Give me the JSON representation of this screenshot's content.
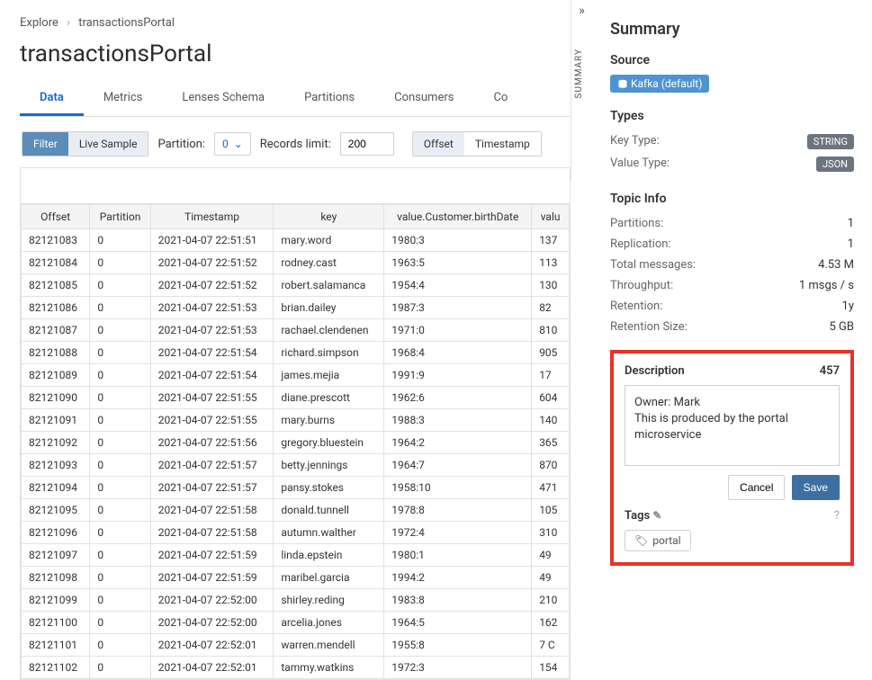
{
  "breadcrumb": {
    "root": "Explore",
    "current": "transactionsPortal"
  },
  "title": "transactionsPortal",
  "tabs": [
    "Data",
    "Metrics",
    "Lenses Schema",
    "Partitions",
    "Consumers",
    "Co"
  ],
  "active_tab": 0,
  "controls": {
    "filter": "Filter",
    "live_sample": "Live Sample",
    "partition_label": "Partition:",
    "partition_value": "0",
    "records_label": "Records limit:",
    "records_value": "200",
    "offset": "Offset",
    "timestamp": "Timestamp"
  },
  "table": {
    "headers": [
      "Offset",
      "Partition",
      "Timestamp",
      "key",
      "value.Customer.birthDate",
      "valu"
    ],
    "rows": [
      [
        "82121083",
        "0",
        "2021-04-07 22:51:51",
        "mary.word",
        "1980:3",
        "137"
      ],
      [
        "82121084",
        "0",
        "2021-04-07 22:51:52",
        "rodney.cast",
        "1963:5",
        "113"
      ],
      [
        "82121085",
        "0",
        "2021-04-07 22:51:52",
        "robert.salamanca",
        "1954:4",
        "130"
      ],
      [
        "82121086",
        "0",
        "2021-04-07 22:51:53",
        "brian.dailey",
        "1987:3",
        "82 "
      ],
      [
        "82121087",
        "0",
        "2021-04-07 22:51:53",
        "rachael.clendenen",
        "1971:0",
        "810"
      ],
      [
        "82121088",
        "0",
        "2021-04-07 22:51:54",
        "richard.simpson",
        "1968:4",
        "905"
      ],
      [
        "82121089",
        "0",
        "2021-04-07 22:51:54",
        "james.mejia",
        "1991:9",
        "17 "
      ],
      [
        "82121090",
        "0",
        "2021-04-07 22:51:55",
        "diane.prescott",
        "1962:6",
        "604"
      ],
      [
        "82121091",
        "0",
        "2021-04-07 22:51:55",
        "mary.burns",
        "1988:3",
        "140"
      ],
      [
        "82121092",
        "0",
        "2021-04-07 22:51:56",
        "gregory.bluestein",
        "1964:2",
        "365"
      ],
      [
        "82121093",
        "0",
        "2021-04-07 22:51:57",
        "betty.jennings",
        "1964:7",
        "870"
      ],
      [
        "82121094",
        "0",
        "2021-04-07 22:51:57",
        "pansy.stokes",
        "1958:10",
        "471"
      ],
      [
        "82121095",
        "0",
        "2021-04-07 22:51:58",
        "donald.tunnell",
        "1978:8",
        "105"
      ],
      [
        "82121096",
        "0",
        "2021-04-07 22:51:58",
        "autumn.walther",
        "1972:4",
        "310"
      ],
      [
        "82121097",
        "0",
        "2021-04-07 22:51:59",
        "linda.epstein",
        "1980:1",
        "49 "
      ],
      [
        "82121098",
        "0",
        "2021-04-07 22:51:59",
        "maribel.garcia",
        "1994:2",
        "49 "
      ],
      [
        "82121099",
        "0",
        "2021-04-07 22:52:00",
        "shirley.reding",
        "1983:8",
        "210"
      ],
      [
        "82121100",
        "0",
        "2021-04-07 22:52:00",
        "arcelia.jones",
        "1964:5",
        "162"
      ],
      [
        "82121101",
        "0",
        "2021-04-07 22:52:01",
        "warren.mendell",
        "1955:8",
        "7 C"
      ],
      [
        "82121102",
        "0",
        "2021-04-07 22:52:01",
        "tammy.watkins",
        "1972:3",
        "154"
      ]
    ]
  },
  "side_label": "SUMMARY",
  "summary": {
    "title": "Summary",
    "source_label": "Source",
    "source_badge": "Kafka (default)",
    "types_label": "Types",
    "key_type_label": "Key Type:",
    "key_type_value": "STRING",
    "value_type_label": "Value Type:",
    "value_type_value": "JSON",
    "topic_info_label": "Topic Info",
    "info": [
      {
        "k": "Partitions:",
        "v": "1"
      },
      {
        "k": "Replication:",
        "v": "1"
      },
      {
        "k": "Total messages:",
        "v": "4.53 M"
      },
      {
        "k": "Throughput:",
        "v": "1 msgs / s"
      },
      {
        "k": "Retention:",
        "v": "1y"
      },
      {
        "k": "Retention Size:",
        "v": "5 GB"
      }
    ],
    "description_label": "Description",
    "description_count": "457",
    "description_text": "Owner: Mark\nThis is produced by the portal microservice",
    "cancel": "Cancel",
    "save": "Save",
    "tags_label": "Tags",
    "tag_value": "portal"
  }
}
